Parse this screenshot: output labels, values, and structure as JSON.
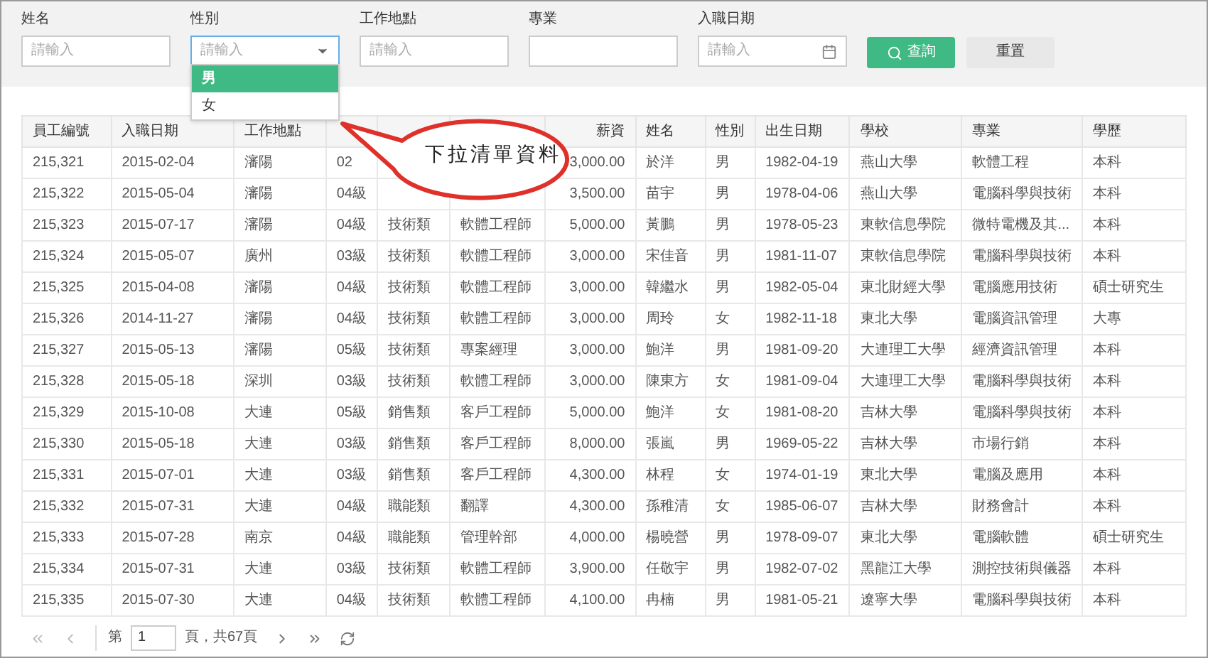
{
  "filters": [
    {
      "label": "姓名",
      "kind": "text",
      "placeholder": "請輸入"
    },
    {
      "label": "性別",
      "kind": "select",
      "placeholder": "請輸入",
      "expanded": true
    },
    {
      "label": "工作地點",
      "kind": "text",
      "placeholder": "請輸入"
    },
    {
      "label": "專業",
      "kind": "text"
    },
    {
      "label": "入職日期",
      "kind": "date",
      "placeholder": "請輸入"
    }
  ],
  "dropdown": [
    {
      "label": "男",
      "selected": true
    },
    {
      "label": "女",
      "selected": false
    }
  ],
  "buttons": [
    {
      "label": "查詢",
      "kind": "primary"
    },
    {
      "label": "重置",
      "kind": "default"
    }
  ],
  "callout": "下拉清單資料",
  "table": {
    "columns": [
      "員工編號",
      "入職日期",
      "工作地點",
      null,
      null,
      null,
      "薪資",
      "姓名",
      "性別",
      "出生日期",
      "學校",
      "專業",
      "學歷"
    ],
    "rows": [
      [
        "215,321",
        "2015-02-04",
        "瀋陽",
        "02",
        null,
        null,
        "3,000.00",
        "於洋",
        "男",
        "1982-04-19",
        "燕山大學",
        "軟體工程",
        "本科"
      ],
      [
        "215,322",
        "2015-05-04",
        "瀋陽",
        "04級",
        null,
        null,
        "3,500.00",
        "苗宇",
        "男",
        "1978-04-06",
        "燕山大學",
        "電腦科學與技術",
        "本科"
      ],
      [
        "215,323",
        "2015-07-17",
        "瀋陽",
        "04級",
        "技術類",
        "軟體工程師",
        "5,000.00",
        "黃鵬",
        "男",
        "1978-05-23",
        "東軟信息學院",
        "微特電機及其...",
        "本科"
      ],
      [
        "215,324",
        "2015-05-07",
        "廣州",
        "03級",
        "技術類",
        "軟體工程師",
        "3,000.00",
        "宋佳音",
        "男",
        "1981-11-07",
        "東軟信息學院",
        "電腦科學與技術",
        "本科"
      ],
      [
        "215,325",
        "2015-04-08",
        "瀋陽",
        "04級",
        "技術類",
        "軟體工程師",
        "3,000.00",
        "韓繼水",
        "男",
        "1982-05-04",
        "東北財經大學",
        "電腦應用技術",
        "碩士研究生"
      ],
      [
        "215,326",
        "2014-11-27",
        "瀋陽",
        "04級",
        "技術類",
        "軟體工程師",
        "3,000.00",
        "周玲",
        "女",
        "1982-11-18",
        "東北大學",
        "電腦資訊管理",
        "大專"
      ],
      [
        "215,327",
        "2015-05-13",
        "瀋陽",
        "05級",
        "技術類",
        "專案經理",
        "3,000.00",
        "鮑洋",
        "男",
        "1981-09-20",
        "大連理工大學",
        "經濟資訊管理",
        "本科"
      ],
      [
        "215,328",
        "2015-05-18",
        "深圳",
        "03級",
        "技術類",
        "軟體工程師",
        "3,000.00",
        "陳東方",
        "女",
        "1981-09-04",
        "大連理工大學",
        "電腦科學與技術",
        "本科"
      ],
      [
        "215,329",
        "2015-10-08",
        "大連",
        "05級",
        "銷售類",
        "客戶工程師",
        "5,000.00",
        "鮑洋",
        "女",
        "1981-08-20",
        "吉林大學",
        "電腦科學與技術",
        "本科"
      ],
      [
        "215,330",
        "2015-05-18",
        "大連",
        "03級",
        "銷售類",
        "客戶工程師",
        "8,000.00",
        "張嵐",
        "男",
        "1969-05-22",
        "吉林大學",
        "市場行銷",
        "本科"
      ],
      [
        "215,331",
        "2015-07-01",
        "大連",
        "03級",
        "銷售類",
        "客戶工程師",
        "4,300.00",
        "林程",
        "女",
        "1974-01-19",
        "東北大學",
        "電腦及應用",
        "本科"
      ],
      [
        "215,332",
        "2015-07-31",
        "大連",
        "04級",
        "職能類",
        "翻譯",
        "4,300.00",
        "孫稚清",
        "女",
        "1985-06-07",
        "吉林大學",
        "財務會計",
        "本科"
      ],
      [
        "215,333",
        "2015-07-28",
        "南京",
        "04級",
        "職能類",
        "管理幹部",
        "4,000.00",
        "楊曉營",
        "男",
        "1978-09-07",
        "東北大學",
        "電腦軟體",
        "碩士研究生"
      ],
      [
        "215,334",
        "2015-07-31",
        "大連",
        "03級",
        "技術類",
        "軟體工程師",
        "3,900.00",
        "任敬宇",
        "男",
        "1982-07-02",
        "黑龍江大學",
        "測控技術與儀器",
        "本科"
      ],
      [
        "215,335",
        "2015-07-30",
        "大連",
        "04級",
        "技術類",
        "軟體工程師",
        "4,100.00",
        "冉楠",
        "男",
        "1981-05-21",
        "遼寧大學",
        "電腦科學與技術",
        "本科"
      ]
    ]
  },
  "pagination": {
    "page_prefix": "第",
    "page": "1",
    "page_suffix": "頁，共67頁"
  }
}
